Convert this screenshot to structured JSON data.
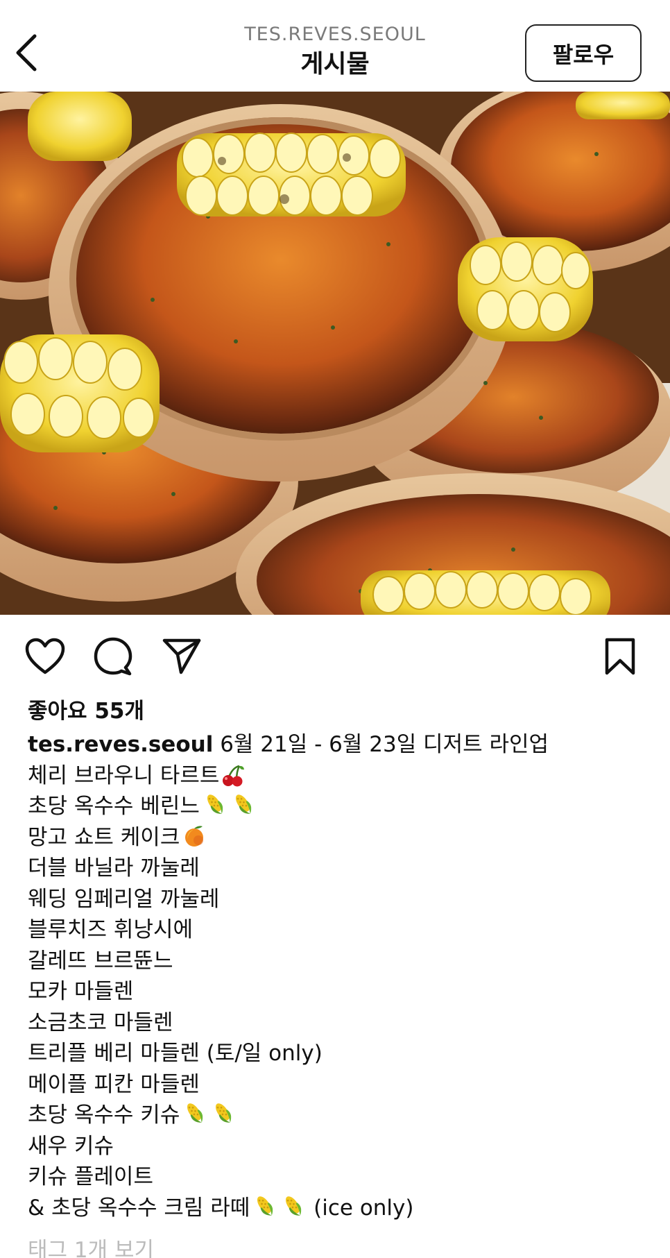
{
  "header": {
    "back_icon": "chevron-left-icon",
    "account_name": "TES.REVES.SEOUL",
    "title": "게시물",
    "follow_label": "팔로우"
  },
  "post": {
    "image_description_icon": "food-photo",
    "actions": {
      "like_icon": "heart-icon",
      "comment_icon": "comment-icon",
      "share_icon": "send-icon",
      "save_icon": "bookmark-icon"
    },
    "likes_text": "좋아요 55개",
    "caption": {
      "username": "tes.reves.seoul",
      "first_line": "6월 21일 - 6월 23일 디저트 라인업",
      "lines": [
        {
          "text": "체리 브라우니 타르트",
          "emoji": [
            "cherry"
          ]
        },
        {
          "text": "초당 옥수수 베린느",
          "emoji": [
            "corn",
            "corn"
          ]
        },
        {
          "text": "망고 쇼트 케이크",
          "emoji": [
            "mango"
          ]
        },
        {
          "text": "더블 바닐라 까눌레",
          "emoji": []
        },
        {
          "text": "웨딩 임페리얼 까눌레",
          "emoji": []
        },
        {
          "text": "블루치즈 휘낭시에",
          "emoji": []
        },
        {
          "text": "갈레뜨 브르뜐느",
          "emoji": []
        },
        {
          "text": "모카 마들렌",
          "emoji": []
        },
        {
          "text": "소금초코 마들렌",
          "emoji": []
        },
        {
          "text": "트리플 베리 마들렌 (토/일 only)",
          "emoji": []
        },
        {
          "text": "메이플 피칸 마들렌",
          "emoji": []
        },
        {
          "text": "초당 옥수수 키슈",
          "emoji": [
            "corn",
            "corn"
          ]
        },
        {
          "text": "새우 키슈",
          "emoji": []
        },
        {
          "text": "키슈 플레이트",
          "emoji": []
        },
        {
          "text": "& 초당 옥수수 크림 라떼",
          "emoji": [
            "corn",
            "corn"
          ],
          "suffix": " (ice only)"
        }
      ],
      "cut_off_line": "태그 1개 보기"
    }
  },
  "colors": {
    "text": "#111111",
    "muted": "#7a7a7a",
    "crust": "#d9b48a",
    "filling": "#c85a1c",
    "corn": "#f2d94a"
  }
}
